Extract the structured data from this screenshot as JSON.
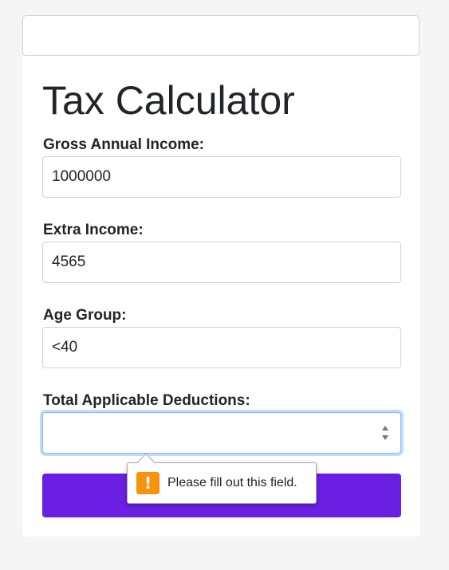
{
  "page": {
    "title": "Tax Calculator"
  },
  "form": {
    "gross_income": {
      "label": "Gross Annual Income:",
      "value": "1000000"
    },
    "extra_income": {
      "label": "Extra Income:",
      "value": "4565"
    },
    "age_group": {
      "label": "Age Group:",
      "value": "<40"
    },
    "deductions": {
      "label": "Total Applicable Deductions:",
      "value": ""
    },
    "submit_label": ""
  },
  "validation": {
    "message": "Please fill out this field.",
    "icon": "warning-icon",
    "icon_glyph": "!",
    "icon_color": "#f7930c"
  },
  "colors": {
    "accent": "#6a1fe3",
    "focus": "#86b7fe"
  }
}
